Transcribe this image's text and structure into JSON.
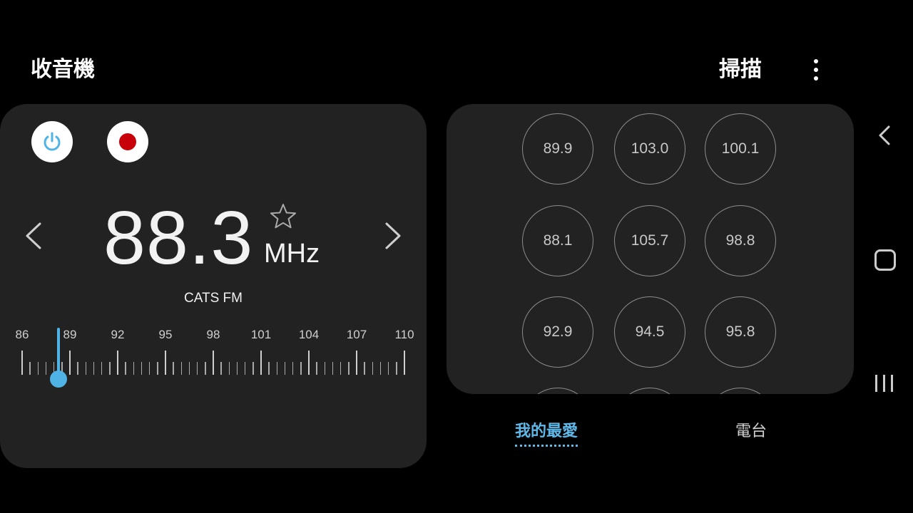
{
  "header": {
    "title": "收音機",
    "scan_label": "掃描",
    "more_icon": "more-vert-icon"
  },
  "tuner": {
    "frequency": "88.3",
    "unit": "MHz",
    "station": "CATS FM",
    "favorite_icon": "star-outline-icon",
    "power_icon": "power-icon",
    "record_icon": "record-icon",
    "accent_color": "#4fb3e6",
    "record_color": "#c8000a",
    "scale_labels": [
      "86",
      "89",
      "92",
      "95",
      "98",
      "101",
      "104",
      "107",
      "110"
    ],
    "scale_range": [
      86,
      110
    ],
    "current_value": 88.3
  },
  "presets": [
    "89.9",
    "103.0",
    "100.1",
    "88.1",
    "105.7",
    "98.8",
    "92.9",
    "94.5",
    "95.8"
  ],
  "tabs": {
    "favorites": "我的最愛",
    "stations": "電台"
  },
  "navbar": {
    "back_icon": "back-icon",
    "home_icon": "home-icon",
    "recents_icon": "recents-icon"
  }
}
